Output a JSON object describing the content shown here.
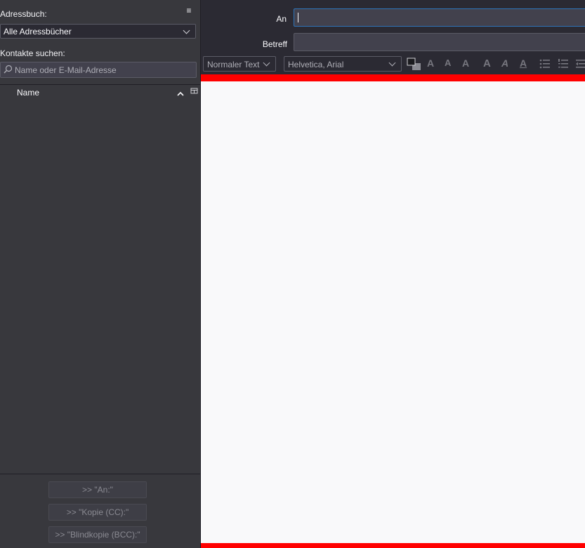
{
  "sidebar": {
    "addressbook_label": "Adressbuch:",
    "addressbook_selected": "Alle Adressbücher",
    "search_label": "Kontakte suchen:",
    "search_placeholder": "Name oder E-Mail-Adresse",
    "column_name": "Name",
    "buttons": {
      "to": ">> \"An:\"",
      "cc": ">> \"Kopie (CC):\"",
      "bcc": ">> \"Blindkopie (BCC):\""
    }
  },
  "compose": {
    "to_label": "An",
    "to_value": "",
    "subject_label": "Betreff",
    "subject_value": ""
  },
  "toolbar": {
    "paragraph_format": "Normaler Text",
    "font": "Helvetica, Arial"
  },
  "colors": {
    "sidebar_bg": "#38383d",
    "header_bg": "#2b2a33",
    "accent": "#ff0000",
    "focus": "#2e74b8",
    "editor_bg": "#f9f9fa"
  },
  "icons": [
    "menu-icon",
    "chevron-down-icon",
    "search-icon",
    "sort-ascending-icon",
    "column-picker-icon",
    "text-color-icon",
    "bold-icon",
    "italic-icon",
    "underline-icon",
    "bulleted-list-icon",
    "numbered-list-icon",
    "outdent-icon"
  ]
}
